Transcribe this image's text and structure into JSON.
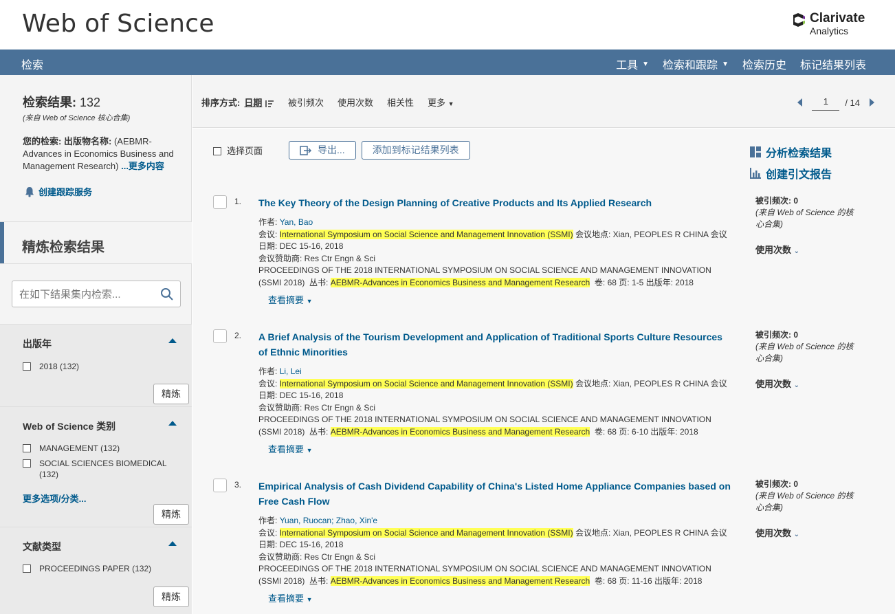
{
  "header": {
    "brand": "Web of Science",
    "logo_name": "Clarivate",
    "logo_sub": "Analytics"
  },
  "nav": {
    "left": "检索",
    "right": [
      {
        "label": "工具",
        "caret": true
      },
      {
        "label": "检索和跟踪",
        "caret": true
      },
      {
        "label": "检索历史",
        "caret": false
      },
      {
        "label": "标记结果列表",
        "caret": false
      }
    ]
  },
  "summary": {
    "title_label": "检索结果:",
    "count": "132",
    "source": "(来自 Web of Science 核心合集)",
    "search_label": "您的检索:",
    "search_field": "出版物名称:",
    "search_text": "(AEBMR-Advances in Economics Business and Management Research)",
    "more": "...更多内容",
    "alert": "创建跟踪服务"
  },
  "refine": {
    "title": "精炼检索结果",
    "search_placeholder": "在如下结果集内检索...",
    "refine_button": "精炼"
  },
  "facets": {
    "year": {
      "title": "出版年",
      "options": [
        "2018 (132)"
      ]
    },
    "category": {
      "title": "Web of Science 类别",
      "options": [
        "MANAGEMENT (132)",
        "SOCIAL SCIENCES BIOMEDICAL (132)"
      ],
      "more": "更多选项/分类..."
    },
    "doctype": {
      "title": "文献类型",
      "options": [
        "PROCEEDINGS PAPER (132)"
      ]
    }
  },
  "sort": {
    "label": "排序方式:",
    "active": "日期",
    "options": [
      "被引频次",
      "使用次数",
      "相关性"
    ],
    "more": "更多"
  },
  "pager": {
    "current": "1",
    "total": "/ 14"
  },
  "toolbar": {
    "select_page": "选择页面",
    "export": "导出...",
    "add_marked": "添加到标记结果列表"
  },
  "side_links": {
    "analyze": "分析检索结果",
    "citation_report": "创建引文报告"
  },
  "records": [
    {
      "num": "1.",
      "title": "The Key Theory of the Design Planning of Creative Products and Its Applied Research",
      "authors_label": "作者:",
      "authors": "Yan, Bao",
      "conf_label": "会议:",
      "conf": "International Symposium on Social Science and Management Innovation (SSMI)",
      "location": "会议地点: Xian, PEOPLES R CHINA 会议日期: DEC 15-16, 2018",
      "sponsor": "会议赞助商: Res Ctr Engn & Sci",
      "proceedings": "PROCEEDINGS OF THE 2018 INTERNATIONAL SYMPOSIUM ON SOCIAL SCIENCE AND MANAGEMENT INNOVATION (SSMI 2018)",
      "series_label": "丛书:",
      "series": "AEBMR-Advances in Economics Business and Management Research",
      "tail": "卷: 68   页: 1-5   出版年: 2018",
      "abstract": "查看摘要",
      "cited_label": "被引频次:",
      "cited": "0",
      "cited_src": "(来自 Web of Science 的核心合集)",
      "usage": "使用次数"
    },
    {
      "num": "2.",
      "title": "A Brief Analysis of the Tourism Development and Application of Traditional Sports Culture Resources of Ethnic Minorities",
      "authors_label": "作者:",
      "authors": "Li, Lei",
      "conf_label": "会议:",
      "conf": "International Symposium on Social Science and Management Innovation (SSMI)",
      "location": "会议地点: Xian, PEOPLES R CHINA 会议日期: DEC 15-16, 2018",
      "sponsor": "会议赞助商: Res Ctr Engn & Sci",
      "proceedings": "PROCEEDINGS OF THE 2018 INTERNATIONAL SYMPOSIUM ON SOCIAL SCIENCE AND MANAGEMENT INNOVATION (SSMI 2018)",
      "series_label": "丛书:",
      "series": "AEBMR-Advances in Economics Business and Management Research",
      "tail": "卷: 68   页: 6-10   出版年: 2018",
      "abstract": "查看摘要",
      "cited_label": "被引频次:",
      "cited": "0",
      "cited_src": "(来自 Web of Science 的核心合集)",
      "usage": "使用次数"
    },
    {
      "num": "3.",
      "title": "Empirical Analysis of Cash Dividend Capability of China's Listed Home Appliance Companies based on Free Cash Flow",
      "authors_label": "作者:",
      "authors": "Yuan, Ruocan; Zhao, Xin'e",
      "conf_label": "会议:",
      "conf": "International Symposium on Social Science and Management Innovation (SSMI)",
      "location": "会议地点: Xian, PEOPLES R CHINA 会议日期: DEC 15-16, 2018",
      "sponsor": "会议赞助商: Res Ctr Engn & Sci",
      "proceedings": "PROCEEDINGS OF THE 2018 INTERNATIONAL SYMPOSIUM ON SOCIAL SCIENCE AND MANAGEMENT INNOVATION (SSMI 2018)",
      "series_label": "丛书:",
      "series": "AEBMR-Advances in Economics Business and Management Research",
      "tail": "卷: 68   页: 11-16   出版年: 2018",
      "abstract": "查看摘要",
      "cited_label": "被引频次:",
      "cited": "0",
      "cited_src": "(来自 Web of Science 的核心合集)",
      "usage": "使用次数"
    }
  ]
}
